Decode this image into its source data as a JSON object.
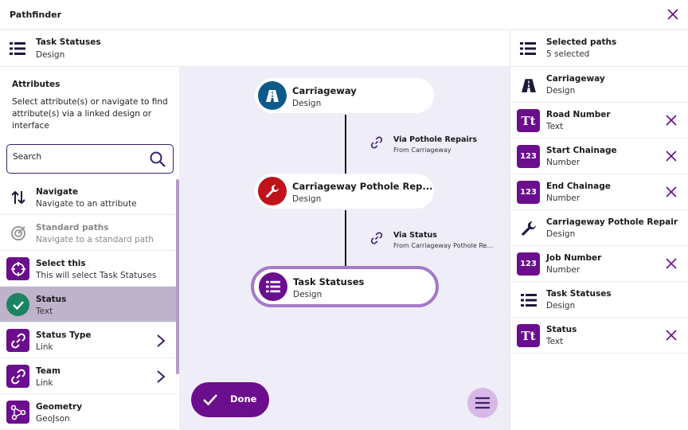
{
  "window": {
    "title": "Pathfinder"
  },
  "context": {
    "title": "Task Statuses",
    "subtitle": "Design"
  },
  "left": {
    "heading": "Attributes",
    "description": "Select attribute(s) or navigate to find attribute(s) via a linked design or interface",
    "search_placeholder": "Search",
    "items": [
      {
        "title": "Navigate",
        "subtitle": "Navigate to an attribute"
      },
      {
        "title": "Standard paths",
        "subtitle": "Navigate to a standard path"
      },
      {
        "title": "Select this",
        "subtitle": "This will select Task Statuses"
      },
      {
        "title": "Status",
        "subtitle": "Text"
      },
      {
        "title": "Status Type",
        "subtitle": "Link"
      },
      {
        "title": "Team",
        "subtitle": "Link"
      },
      {
        "title": "Geometry",
        "subtitle": "GeoJson"
      }
    ]
  },
  "canvas": {
    "nodes": [
      {
        "title": "Carriageway",
        "subtitle": "Design"
      },
      {
        "title": "Carriageway Pothole Rep...",
        "subtitle": "Design"
      },
      {
        "title": "Task Statuses",
        "subtitle": "Design"
      }
    ],
    "links": [
      {
        "title": "Via Pothole Repairs",
        "subtitle": "From Carriageway"
      },
      {
        "title": "Via Status",
        "subtitle": "From Carriageway Pothole Re..."
      }
    ],
    "done_label": "Done"
  },
  "right": {
    "title": "Selected paths",
    "subtitle": "5 selected",
    "items": [
      {
        "title": "Carriageway",
        "subtitle": "Design"
      },
      {
        "title": "Road Number",
        "subtitle": "Text"
      },
      {
        "title": "Start Chainage",
        "subtitle": "Number"
      },
      {
        "title": "End Chainage",
        "subtitle": "Number"
      },
      {
        "title": "Carriageway Pothole Repair",
        "subtitle": "Design"
      },
      {
        "title": "Job Number",
        "subtitle": "Number"
      },
      {
        "title": "Task Statuses",
        "subtitle": "Design"
      },
      {
        "title": "Status",
        "subtitle": "Text"
      }
    ]
  },
  "icons": {
    "text_glyph": "Tt",
    "number_glyph": "123"
  },
  "colors": {
    "brand_purple": "#6b0e8e",
    "selected_row": "#bfb3cc",
    "canvas_bg": "#efedf8",
    "road_blue": "#0e5a8a",
    "repair_red": "#c0121a",
    "check_green": "#1a8560"
  }
}
